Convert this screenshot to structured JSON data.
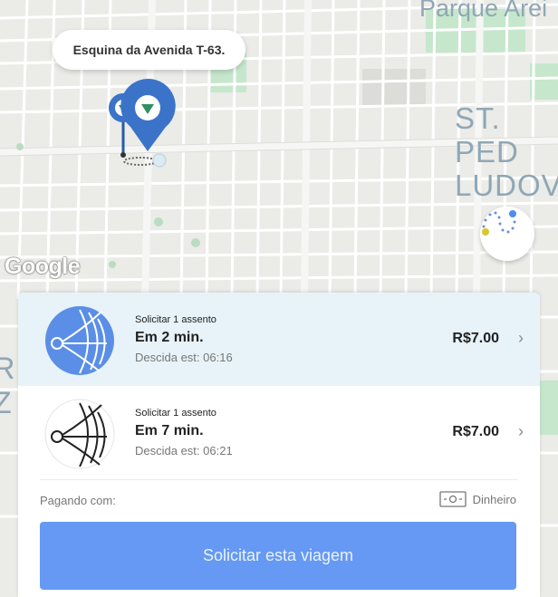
{
  "map": {
    "place_labels": {
      "parque": "Parque Arei",
      "st_line1": "ST. PED",
      "st_line2": "LUDOV",
      "left_line1": "R",
      "left_line2": "Z"
    },
    "google_logo": "Google",
    "pickup_callout": "Esquina da Avenida T-63."
  },
  "options": [
    {
      "request_label": "Solicitar 1 assento",
      "eta": "Em 2 min.",
      "dropoff": "Descida est: 06:16",
      "price": "R$7.00",
      "selected": true,
      "icon": "transit-line-icon-filled"
    },
    {
      "request_label": "Solicitar 1 assento",
      "eta": "Em 7 min.",
      "dropoff": "Descida est: 06:21",
      "price": "R$7.00",
      "selected": false,
      "icon": "transit-line-icon-outline"
    }
  ],
  "payment": {
    "label": "Pagando com:",
    "method": "Dinheiro",
    "icon": "cash-icon"
  },
  "cta": {
    "label": "Solicitar esta viagem"
  },
  "colors": {
    "accent": "#6599f3",
    "selected_bg": "#e7f3f8",
    "pin_blue": "#3b73c9",
    "pin_green": "#2f8f65"
  }
}
